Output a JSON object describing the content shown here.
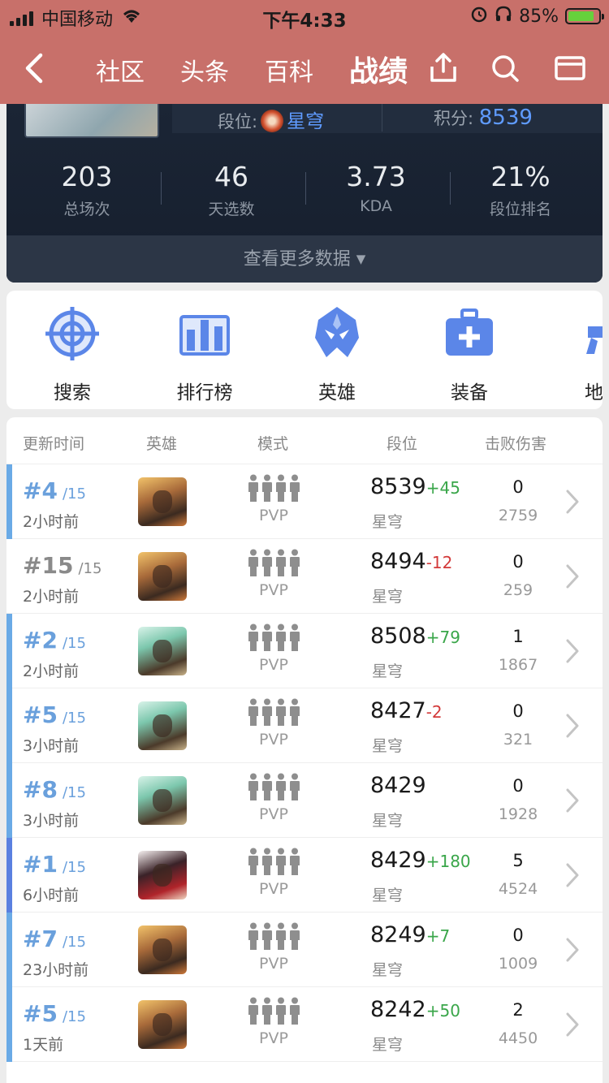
{
  "status_bar": {
    "carrier": "中国移动",
    "time": "下午4:33",
    "battery": "85%"
  },
  "nav": {
    "tabs": [
      "社区",
      "头条",
      "百科"
    ],
    "active_tab": "战绩"
  },
  "profile": {
    "rank_label": "段位:",
    "rank_name": "星穹",
    "score_label": "积分:",
    "score_value": "8539",
    "stats": [
      {
        "value": "203",
        "label": "总场次"
      },
      {
        "value": "46",
        "label": "天选数"
      },
      {
        "value": "3.73",
        "label": "KDA"
      },
      {
        "value": "21%",
        "label": "段位排名"
      }
    ],
    "more_label": "查看更多数据"
  },
  "quick_menu": [
    {
      "label": "搜索",
      "icon": "crosshair-icon"
    },
    {
      "label": "排行榜",
      "icon": "leaderboard-icon"
    },
    {
      "label": "英雄",
      "icon": "hero-mask-icon"
    },
    {
      "label": "装备",
      "icon": "equipment-kit-icon"
    },
    {
      "label": "地",
      "icon": "map-icon"
    }
  ],
  "table": {
    "headers": [
      "更新时间",
      "英雄",
      "模式",
      "段位",
      "击败伤害"
    ],
    "rows": [
      {
        "place": "#4",
        "of": "/15",
        "time": "2小时前",
        "mode": "PVP",
        "score": "8539",
        "delta": "+45",
        "rank": "星穹",
        "kills": "0",
        "damage": "2759"
      },
      {
        "place": "#15",
        "of": "/15",
        "time": "2小时前",
        "mode": "PVP",
        "score": "8494",
        "delta": "-12",
        "rank": "星穹",
        "kills": "0",
        "damage": "259"
      },
      {
        "place": "#2",
        "of": "/15",
        "time": "2小时前",
        "mode": "PVP",
        "score": "8508",
        "delta": "+79",
        "rank": "星穹",
        "kills": "1",
        "damage": "1867"
      },
      {
        "place": "#5",
        "of": "/15",
        "time": "3小时前",
        "mode": "PVP",
        "score": "8427",
        "delta": "-2",
        "rank": "星穹",
        "kills": "0",
        "damage": "321"
      },
      {
        "place": "#8",
        "of": "/15",
        "time": "3小时前",
        "mode": "PVP",
        "score": "8429",
        "delta": "",
        "rank": "星穹",
        "kills": "0",
        "damage": "1928"
      },
      {
        "place": "#1",
        "of": "/15",
        "time": "6小时前",
        "mode": "PVP",
        "score": "8429",
        "delta": "+180",
        "rank": "星穹",
        "kills": "5",
        "damage": "4524"
      },
      {
        "place": "#7",
        "of": "/15",
        "time": "23小时前",
        "mode": "PVP",
        "score": "8249",
        "delta": "+7",
        "rank": "星穹",
        "kills": "0",
        "damage": "1009"
      },
      {
        "place": "#5",
        "of": "/15",
        "time": "1天前",
        "mode": "PVP",
        "score": "8242",
        "delta": "+50",
        "rank": "星穹",
        "kills": "2",
        "damage": "4450"
      }
    ]
  },
  "colors": {
    "nav_bg": "#c8706a",
    "accent_blue": "#5f9bff",
    "gain_green": "#3aa64a",
    "loss_red": "#d33a3a"
  }
}
